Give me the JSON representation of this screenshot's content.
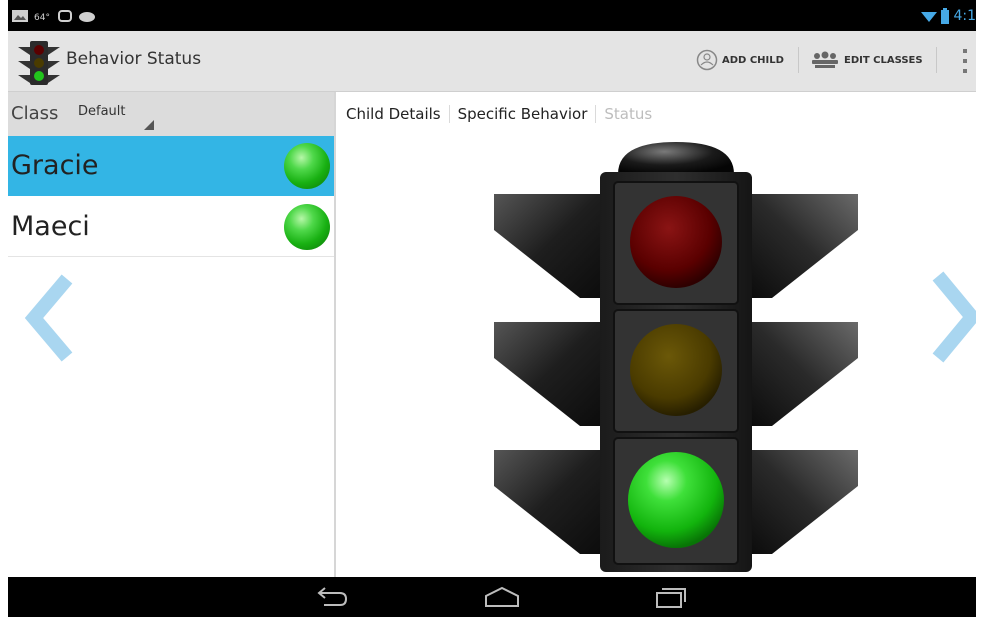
{
  "status_bar": {
    "time": "4:1",
    "icons": [
      "gallery-icon",
      "weather-icon",
      "sync-icon",
      "wifi-icon",
      "battery-icon"
    ]
  },
  "action_bar": {
    "title": "Behavior Status",
    "add_child_label": "ADD CHILD",
    "edit_classes_label": "EDIT CLASSES"
  },
  "left_panel": {
    "class_label": "Class",
    "class_value": "Default",
    "children": [
      {
        "name": "Gracie",
        "status": "green",
        "selected": true
      },
      {
        "name": "Maeci",
        "status": "green",
        "selected": false
      }
    ]
  },
  "tabs": [
    {
      "label": "Child Details",
      "active": true
    },
    {
      "label": "Specific Behavior",
      "active": true
    },
    {
      "label": "Status",
      "active": false
    }
  ],
  "traffic_light": {
    "red": "off",
    "yellow": "off",
    "green": "on"
  },
  "colors": {
    "accent": "#33b5e5",
    "arrow": "#a9d6f0",
    "green_light": "#1fc01a",
    "red_off": "#5a0000",
    "yellow_off": "#4a3b00"
  }
}
